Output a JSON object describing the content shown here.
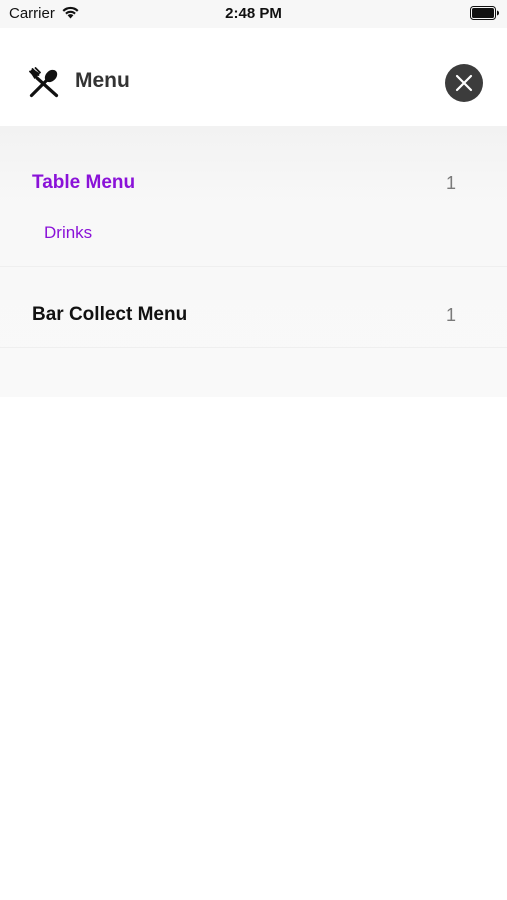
{
  "status_bar": {
    "carrier": "Carrier",
    "time": "2:48 PM"
  },
  "header": {
    "title": "Menu",
    "icon": "utensils-icon",
    "close_icon": "close-icon"
  },
  "menus": [
    {
      "title": "Table Menu",
      "count": "1",
      "active": true,
      "items": [
        {
          "label": "Drinks"
        }
      ]
    },
    {
      "title": "Bar Collect Menu",
      "count": "1",
      "active": false,
      "items": []
    }
  ],
  "colors": {
    "accent": "#8a12d8",
    "close_button": "#3c3c3c",
    "panel_background": "#f8f8f8"
  }
}
